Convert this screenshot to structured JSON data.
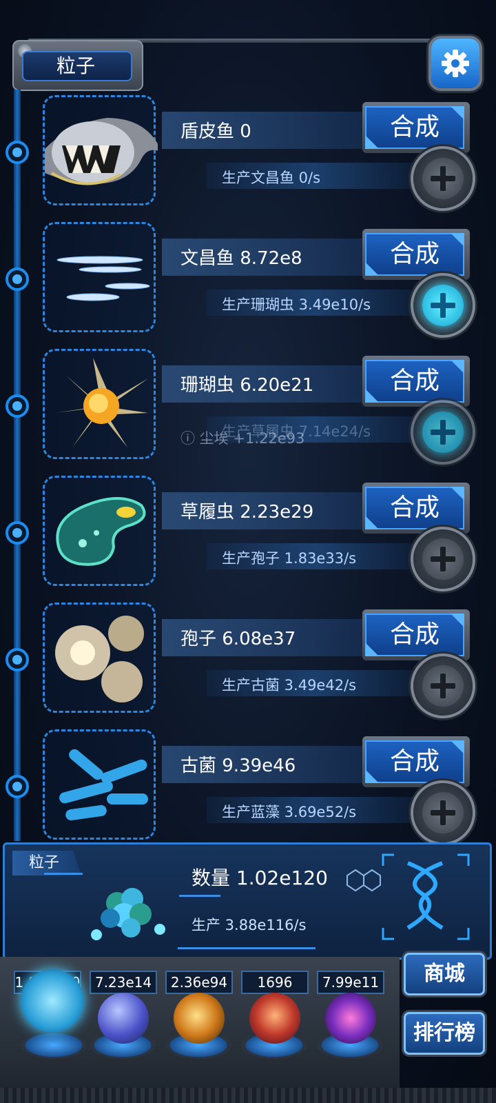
{
  "header": {
    "title": "粒子"
  },
  "rows": [
    {
      "name": "盾皮鱼 0",
      "production": "生产文昌鱼 0/s",
      "craft_label": "合成",
      "plus_active": false,
      "creature": "dunkleosteus"
    },
    {
      "name": "文昌鱼 8.72e8",
      "production": "生产珊瑚虫 3.49e10/s",
      "craft_label": "合成",
      "plus_active": true,
      "creature": "lancelet"
    },
    {
      "name": "珊瑚虫 6.20e21",
      "production": "生产草履虫 7.14e24/s",
      "craft_label": "合成",
      "plus_active": true,
      "creature": "coral-polyp"
    },
    {
      "name": "草履虫 2.23e29",
      "production": "生产孢子 1.83e33/s",
      "craft_label": "合成",
      "plus_active": false,
      "creature": "paramecium"
    },
    {
      "name": "孢子 6.08e37",
      "production": "生产古菌 3.49e42/s",
      "craft_label": "合成",
      "plus_active": false,
      "creature": "spores"
    },
    {
      "name": "古菌 9.39e46",
      "production": "生产蓝藻 3.69e52/s",
      "craft_label": "合成",
      "plus_active": false,
      "creature": "archaea"
    }
  ],
  "toast": "ⓘ 尘埃 +1.22e93",
  "info": {
    "tag": "粒子",
    "quantity": "数量 1.02e120",
    "rate": "生产 3.88e116/s"
  },
  "resources": [
    "1.02e120",
    "7.23e14",
    "2.36e94",
    "1696",
    "7.99e11"
  ],
  "side_buttons": {
    "shop": "商城",
    "ranking": "排行榜"
  },
  "colors": {
    "accent": "#1f6fd0",
    "frame": "#5e6875",
    "plus_active": "#36d4ff"
  }
}
